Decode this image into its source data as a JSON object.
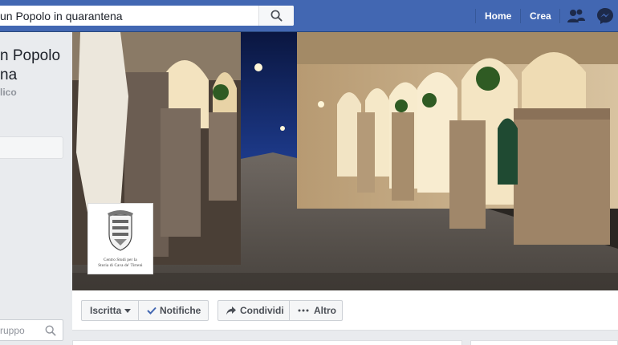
{
  "topbar": {
    "search_value": "un Popolo in quarantena",
    "nav_home": "Home",
    "nav_crea": "Crea",
    "friends_icon": "friend-requests-icon",
    "messenger_icon": "messenger-icon"
  },
  "group": {
    "title_line1": "n Popolo",
    "title_line2": "na",
    "privacy": "lico"
  },
  "left_search": {
    "value": "ruppo"
  },
  "cover": {
    "logo_caption_line1": "Centro Studi per la",
    "logo_caption_line2": "Storia di Cava de' Tirreni"
  },
  "actions": {
    "joined_label": "Iscritta",
    "notifications_label": "Notifiche",
    "share_label": "Condividi",
    "more_label": "Altro"
  },
  "colors": {
    "topbar": "#4267b2",
    "page_bg": "#e9ebee",
    "link_blue": "#4267b2"
  }
}
